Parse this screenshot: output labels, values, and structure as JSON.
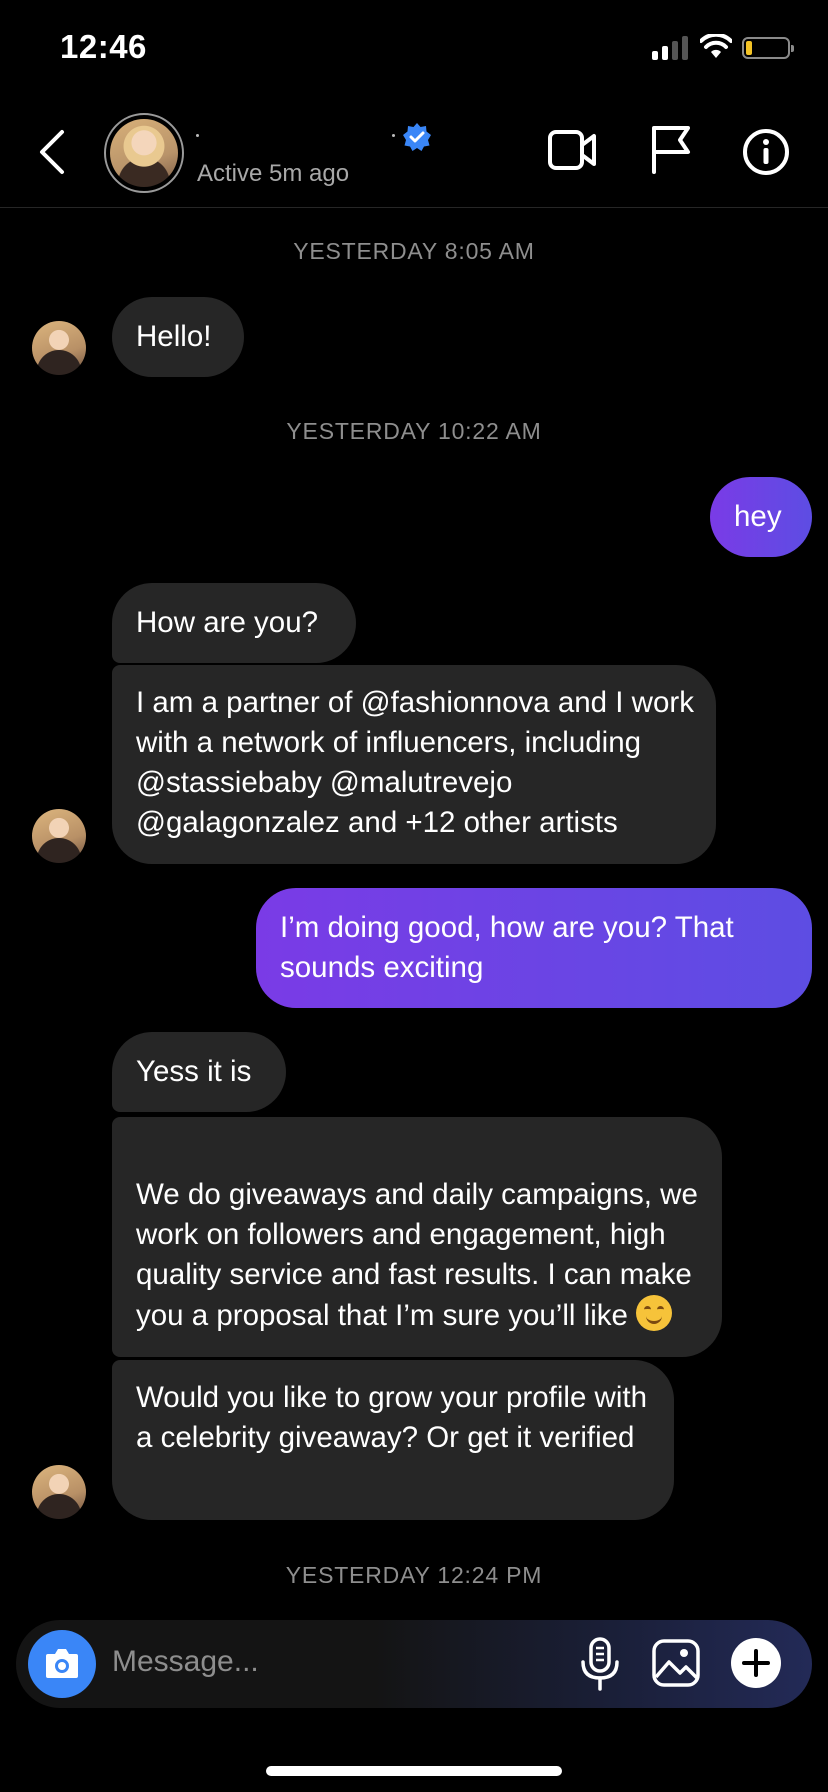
{
  "status_bar": {
    "time": "12:46"
  },
  "header": {
    "active_status": "Active 5m ago",
    "icons": [
      "back-icon",
      "verified-badge-icon",
      "video-call-icon",
      "flag-icon",
      "info-icon"
    ]
  },
  "colors": {
    "outgoing_bubble": "#6a45e6",
    "incoming_bubble": "#262626",
    "camera_button": "#3a86f7",
    "verified": "#3a86f7"
  },
  "timestamps": [
    "YESTERDAY 8:05 AM",
    "YESTERDAY 10:22 AM",
    "YESTERDAY 12:24 PM"
  ],
  "messages": [
    {
      "from": "them",
      "text": "Hello!"
    },
    {
      "from": "me",
      "text": "hey"
    },
    {
      "from": "them",
      "text": "How are you?"
    },
    {
      "from": "them",
      "text": "I am a partner of @fashionnova and I work with a network of influencers, including @stassiebaby @malutrevejo @galagonzalez and +12 other artists"
    },
    {
      "from": "me",
      "text": "I’m doing good, how are you? That sounds exciting"
    },
    {
      "from": "them",
      "text": "Yess it is"
    },
    {
      "from": "them",
      "text": "We do giveaways and daily campaigns, we work on followers and engagement, high quality service and fast results. I can make you a proposal that I’m sure you’ll like",
      "emoji": "smiling-face-emoji"
    },
    {
      "from": "them",
      "text": "Would you like to grow your profile with a celebrity giveaway? Or get it verified"
    }
  ],
  "composer": {
    "placeholder": "Message...",
    "icons": [
      "camera-icon",
      "microphone-icon",
      "gallery-icon",
      "plus-icon"
    ]
  }
}
